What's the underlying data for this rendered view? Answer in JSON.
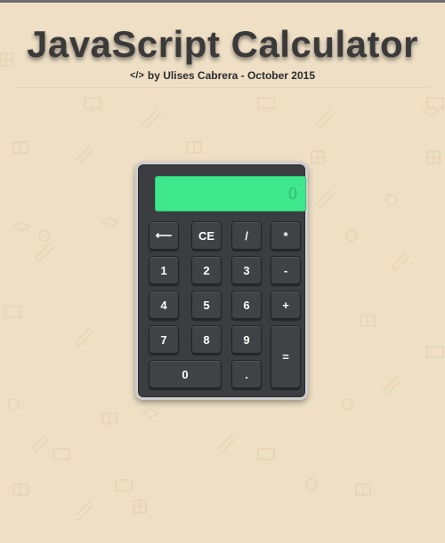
{
  "header": {
    "title": "JavaScript Calculator",
    "code_icon": "</>",
    "byline": "by Ulises Cabrera - October 2015"
  },
  "calculator": {
    "display_value": "0",
    "display_color": "#3fe88c",
    "body_color": "#3b3d40",
    "keys": {
      "back": "⟵",
      "ce": "CE",
      "divide": "/",
      "multiply": "*",
      "one": "1",
      "two": "2",
      "three": "3",
      "minus": "-",
      "four": "4",
      "five": "5",
      "six": "6",
      "plus": "+",
      "seven": "7",
      "eight": "8",
      "nine": "9",
      "equals": "=",
      "zero": "0",
      "dot": "."
    }
  },
  "colors": {
    "page_background": "#eedfc5"
  }
}
